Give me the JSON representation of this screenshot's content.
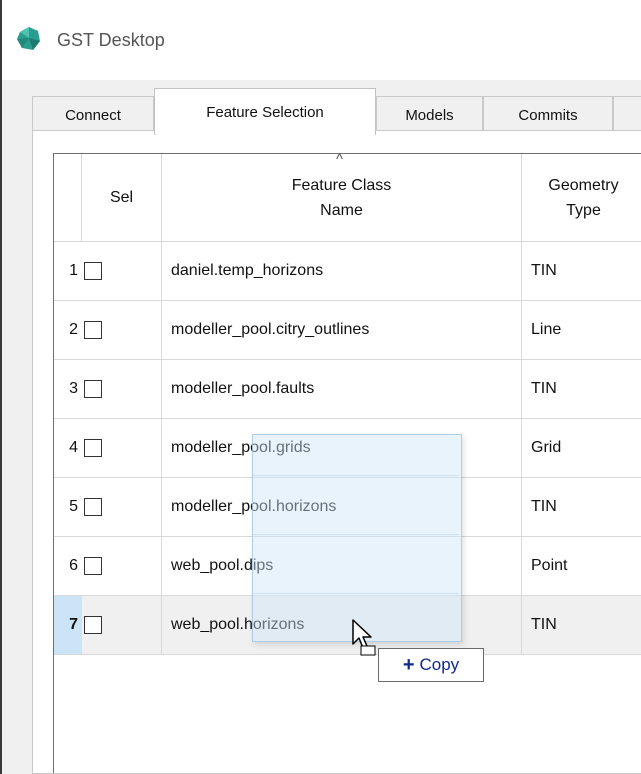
{
  "window": {
    "title": "GST Desktop",
    "app_icon": "gst-logo-icon"
  },
  "tabs": [
    {
      "label": "Connect",
      "active": false
    },
    {
      "label": "Feature Selection",
      "active": true
    },
    {
      "label": "Models",
      "active": false
    },
    {
      "label": "Commits",
      "active": false
    }
  ],
  "grid": {
    "sort_indicator": "^",
    "columns": {
      "sel": "Sel",
      "name_line1": "Feature Class",
      "name_line2": "Name",
      "geom_line1": "Geometry",
      "geom_line2": "Type"
    },
    "rows": [
      {
        "num": "1",
        "name": "daniel.temp_horizons",
        "geometry": "TIN",
        "checked": false
      },
      {
        "num": "2",
        "name": "modeller_pool.citry_outlines",
        "geometry": "Line",
        "checked": false
      },
      {
        "num": "3",
        "name": "modeller_pool.faults",
        "geometry": "TIN",
        "checked": false
      },
      {
        "num": "4",
        "name": "modeller_pool.grids",
        "geometry": "Grid",
        "checked": false
      },
      {
        "num": "5",
        "name": "modeller_pool.horizons",
        "geometry": "TIN",
        "checked": false
      },
      {
        "num": "6",
        "name": "web_pool.dips",
        "geometry": "Point",
        "checked": false
      },
      {
        "num": "7",
        "name": "web_pool.horizons",
        "geometry": "TIN",
        "checked": false,
        "selected": true
      }
    ]
  },
  "drag": {
    "tooltip_plus": "+",
    "tooltip_label": "Copy"
  },
  "colors": {
    "selection": "#cce4f7",
    "tooltip_text": "#0f2a8c",
    "logo": "#2a9d8f"
  }
}
